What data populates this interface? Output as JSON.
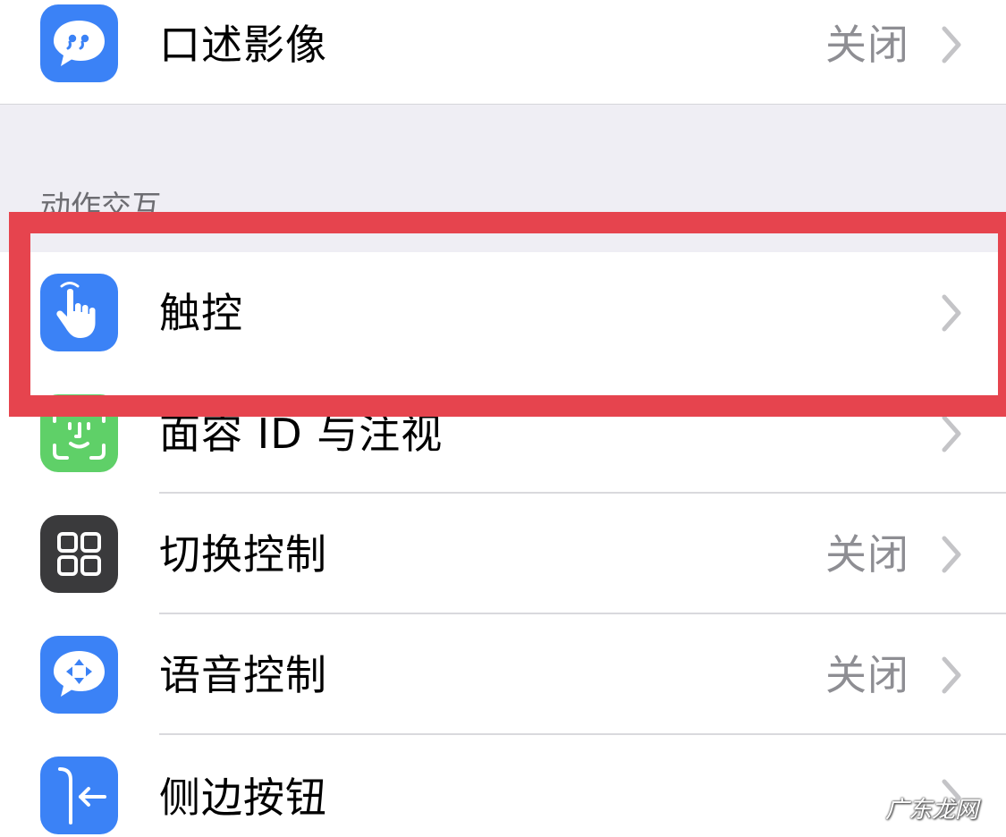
{
  "settings": {
    "audio_description": {
      "label": "口述影像",
      "value": "关闭",
      "icon": "speech-bubble-quote-icon",
      "color": "#3b82f6"
    },
    "section_header": "动作交互",
    "touch": {
      "label": "触控",
      "icon": "hand-pointer-icon",
      "color": "#3b82f6"
    },
    "face_id": {
      "label": "面容 ID 与注视",
      "icon": "face-id-icon",
      "color": "#5fd068"
    },
    "switch_control": {
      "label": "切换控制",
      "value": "关闭",
      "icon": "grid-four-icon",
      "color": "#3a3a3c"
    },
    "voice_control": {
      "label": "语音控制",
      "value": "关闭",
      "icon": "speech-bubble-arrows-icon",
      "color": "#3b82f6"
    },
    "side_button": {
      "label": "侧边按钮",
      "icon": "side-button-icon",
      "color": "#3b82f6"
    }
  },
  "watermark": "广东龙网"
}
